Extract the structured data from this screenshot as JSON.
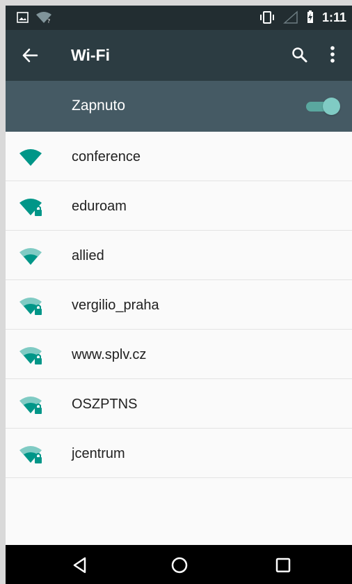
{
  "status_bar": {
    "time": "1:11",
    "left_icons": [
      "image-icon",
      "wifi-unknown-icon"
    ],
    "right_icons": [
      "vibrate-icon",
      "signal-icon",
      "battery-charging-icon"
    ]
  },
  "app_bar": {
    "title": "Wi-Fi",
    "back_icon": "arrow-left-icon",
    "search_icon": "search-icon",
    "more_icon": "more-vert-icon",
    "background": "#2c3c42"
  },
  "wifi_toggle": {
    "label": "Zapnuto",
    "enabled": true,
    "background": "#455a64",
    "accent": "#80cbc4"
  },
  "networks": [
    {
      "name": "conference",
      "secured": false,
      "signal": "full"
    },
    {
      "name": "eduroam",
      "secured": true,
      "signal": "full"
    },
    {
      "name": "allied",
      "secured": false,
      "signal": "medium"
    },
    {
      "name": "vergilio_praha",
      "secured": true,
      "signal": "medium"
    },
    {
      "name": "www.splv.cz",
      "secured": true,
      "signal": "medium"
    },
    {
      "name": "OSZPTNS",
      "secured": true,
      "signal": "medium"
    },
    {
      "name": "jcentrum",
      "secured": true,
      "signal": "medium"
    }
  ],
  "navigation_bar": {
    "buttons": [
      "back-triangle-icon",
      "home-circle-icon",
      "recents-square-icon"
    ]
  },
  "colors": {
    "wifi_teal": "#009688",
    "wifi_light": "#80cbc4",
    "list_background": "#fafafa",
    "text": "#212121"
  }
}
